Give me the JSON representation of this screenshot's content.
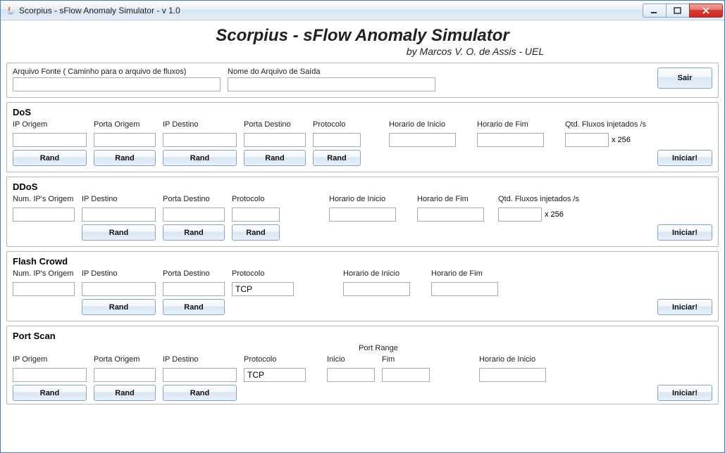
{
  "window": {
    "title": "Scorpius - sFlow Anomaly Simulator - v 1.0"
  },
  "header": {
    "title": "Scorpius - sFlow Anomaly Simulator",
    "subtitle": "by Marcos V. O. de Assis - UEL"
  },
  "topPanel": {
    "sourceLabel": "Arquivo Fonte ( Caminho para o arquivo de fluxos)",
    "sourceValue": "",
    "outputLabel": "Nome do Arquivo de Saída",
    "outputValue": "",
    "exitLabel": "Sair"
  },
  "common": {
    "randLabel": "Rand",
    "iniciarLabel": "Iniciar!",
    "x256": "x 256"
  },
  "dos": {
    "title": "DoS",
    "ipOrigem": "IP Origem",
    "portaOrigem": "Porta Origem",
    "ipDestino": "IP Destino",
    "portaDestino": "Porta Destino",
    "protocolo": "Protocolo",
    "horarioInicio": "Horario de Inicio",
    "horarioFim": "Horario de Fim",
    "qtdFluxos": "Qtd. Fluxos injetados /s"
  },
  "ddos": {
    "title": "DDoS",
    "numIpsOrigem": "Num. IP's Origem",
    "ipDestino": "IP Destino",
    "portaDestino": "Porta Destino",
    "protocolo": "Protocolo",
    "horarioInicio": "Horario de Inicio",
    "horarioFim": "Horario de Fim",
    "qtdFluxos": "Qtd. Fluxos injetados /s"
  },
  "flash": {
    "title": "Flash Crowd",
    "numIpsOrigem": "Num. IP's Origem",
    "ipDestino": "IP Destino",
    "portaDestino": "Porta Destino",
    "protocolo": "Protocolo",
    "protocoloValue": "TCP",
    "horarioInicio": "Horario de Inicio",
    "horarioFim": "Horario de Fim"
  },
  "portscan": {
    "title": "Port Scan",
    "ipOrigem": "IP Origem",
    "portaOrigem": "Porta Origem",
    "ipDestino": "IP Destino",
    "protocolo": "Protocolo",
    "protocoloValue": "TCP",
    "portRange": "Port Range",
    "inicio": "Inicio",
    "fim": "Fim",
    "horarioInicio": "Horario de Inicio"
  }
}
